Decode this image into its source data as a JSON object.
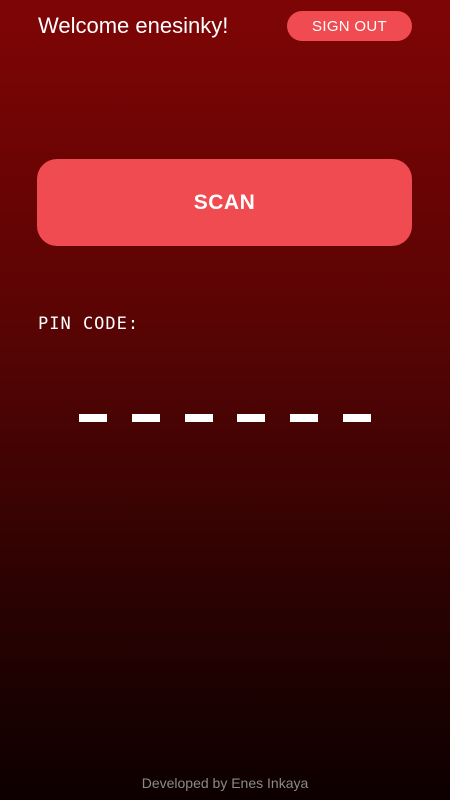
{
  "header": {
    "welcome_text": "Welcome enesinky!",
    "signout_label": "SIGN OUT"
  },
  "main": {
    "scan_label": "SCAN",
    "pin_label": "PIN CODE:",
    "pin_slots": [
      "",
      "",
      "",
      "",
      "",
      ""
    ]
  },
  "footer": {
    "credit": "Developed by Enes Inkaya"
  },
  "colors": {
    "accent": "#ef4b50",
    "background_top": "#7f0505",
    "background_bottom": "#0d0000",
    "text": "#ffffff",
    "footer_text": "#8a8a8a"
  }
}
